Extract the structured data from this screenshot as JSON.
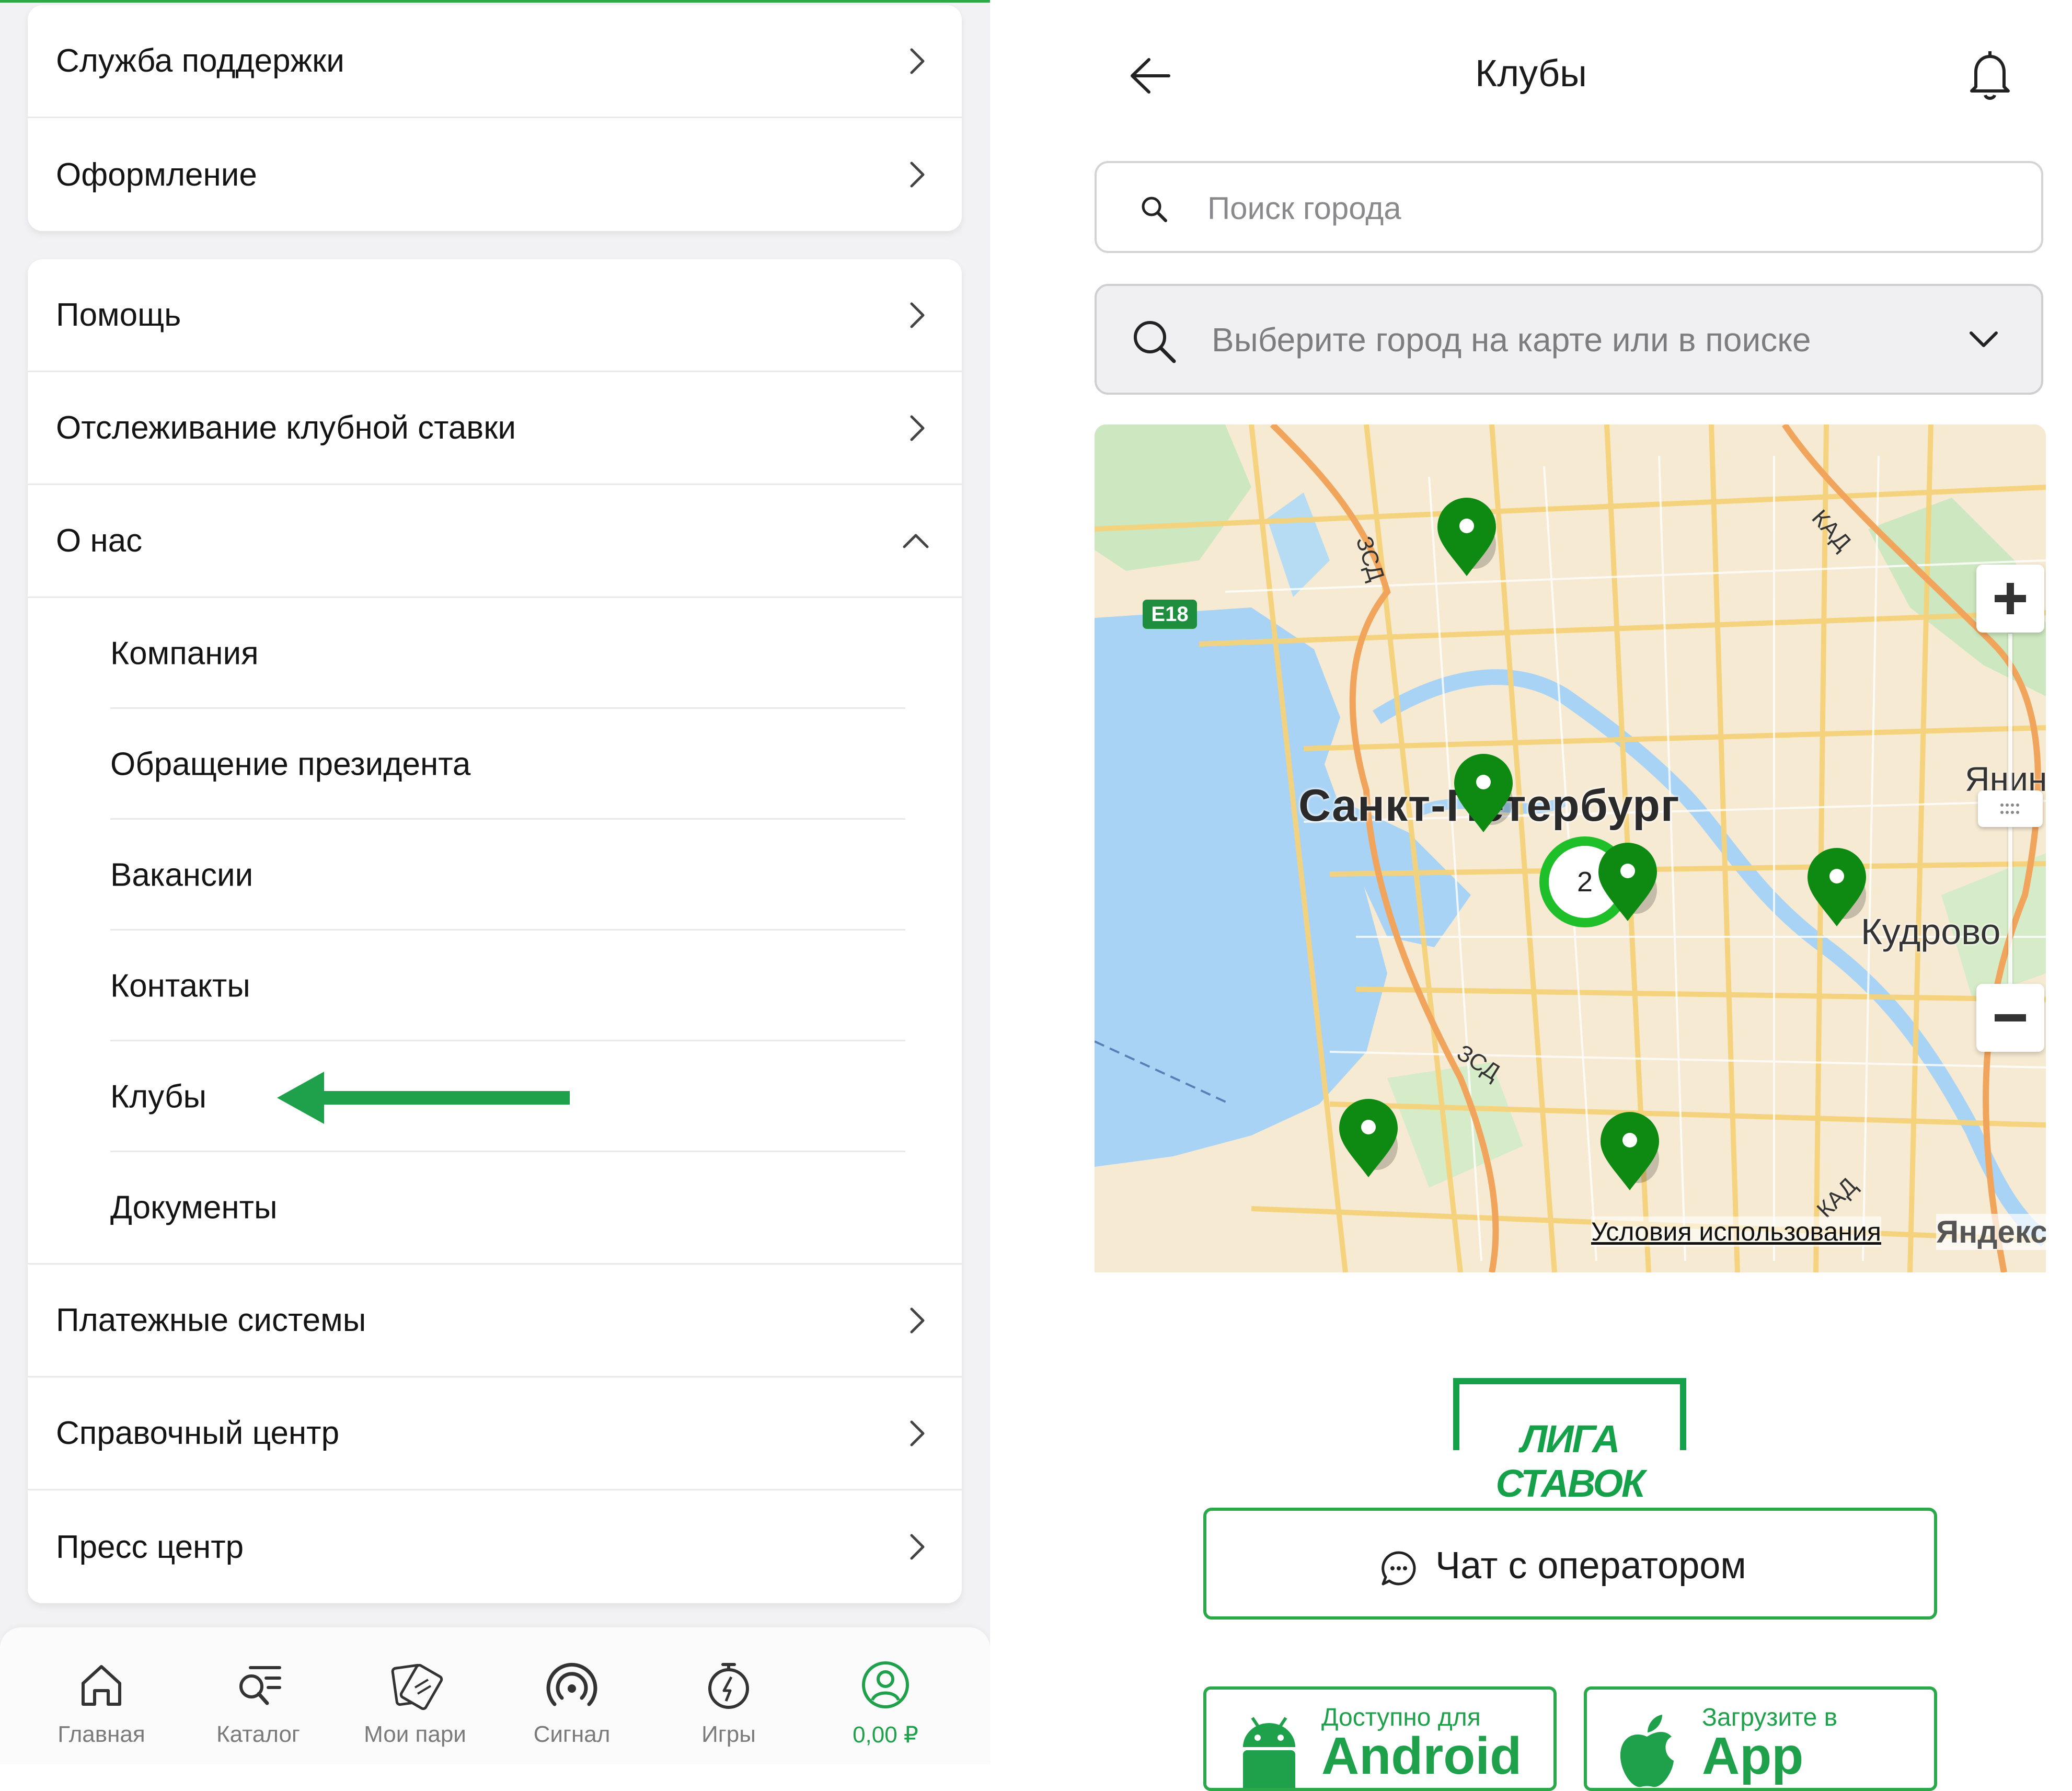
{
  "left_menu": {
    "card1": [
      "Служба поддержки",
      "Оформление"
    ],
    "card2_top": [
      "Помощь",
      "Отслеживание клубной ставки"
    ],
    "about": {
      "label": "О нас",
      "subitems": [
        "Компания",
        "Обращение президента",
        "Вакансии",
        "Контакты",
        "Клубы",
        "Документы"
      ]
    },
    "card2_bottom": [
      "Платежные системы",
      "Справочный центр",
      "Пресс центр"
    ]
  },
  "bottom_nav": {
    "items": [
      {
        "label": "Главная",
        "icon": "home-icon"
      },
      {
        "label": "Каталог",
        "icon": "catalog-search-icon"
      },
      {
        "label": "Мои пари",
        "icon": "tickets-icon"
      },
      {
        "label": "Сигнал",
        "icon": "signal-icon"
      },
      {
        "label": "Игры",
        "icon": "stopwatch-icon"
      },
      {
        "label": "0,00 ₽",
        "icon": "profile-icon",
        "active": true
      }
    ]
  },
  "clubs_page": {
    "title": "Клубы",
    "search_placeholder": "Поиск города",
    "city_select_text": "Выберите город на карте или в поиске",
    "map": {
      "city_label": "Санкт-Петербург",
      "labels": [
        "Кудрово",
        "Янин",
        "E18",
        "ЗСД",
        "КАД"
      ],
      "cluster_count": "2",
      "terms_link": "Условия использования",
      "provider": "Яндекс"
    },
    "logo_text": "ЛИГА СТАВОК",
    "chat_button": "Чат с оператором",
    "stores": [
      {
        "line1": "Доступно для",
        "line2": "Android"
      },
      {
        "line1": "Загрузите в",
        "line2": "App Store"
      }
    ]
  },
  "colors": {
    "brand_green": "#1ea14a",
    "pin_green": "#1a8f1a",
    "arrow_green": "#1ea14a"
  }
}
